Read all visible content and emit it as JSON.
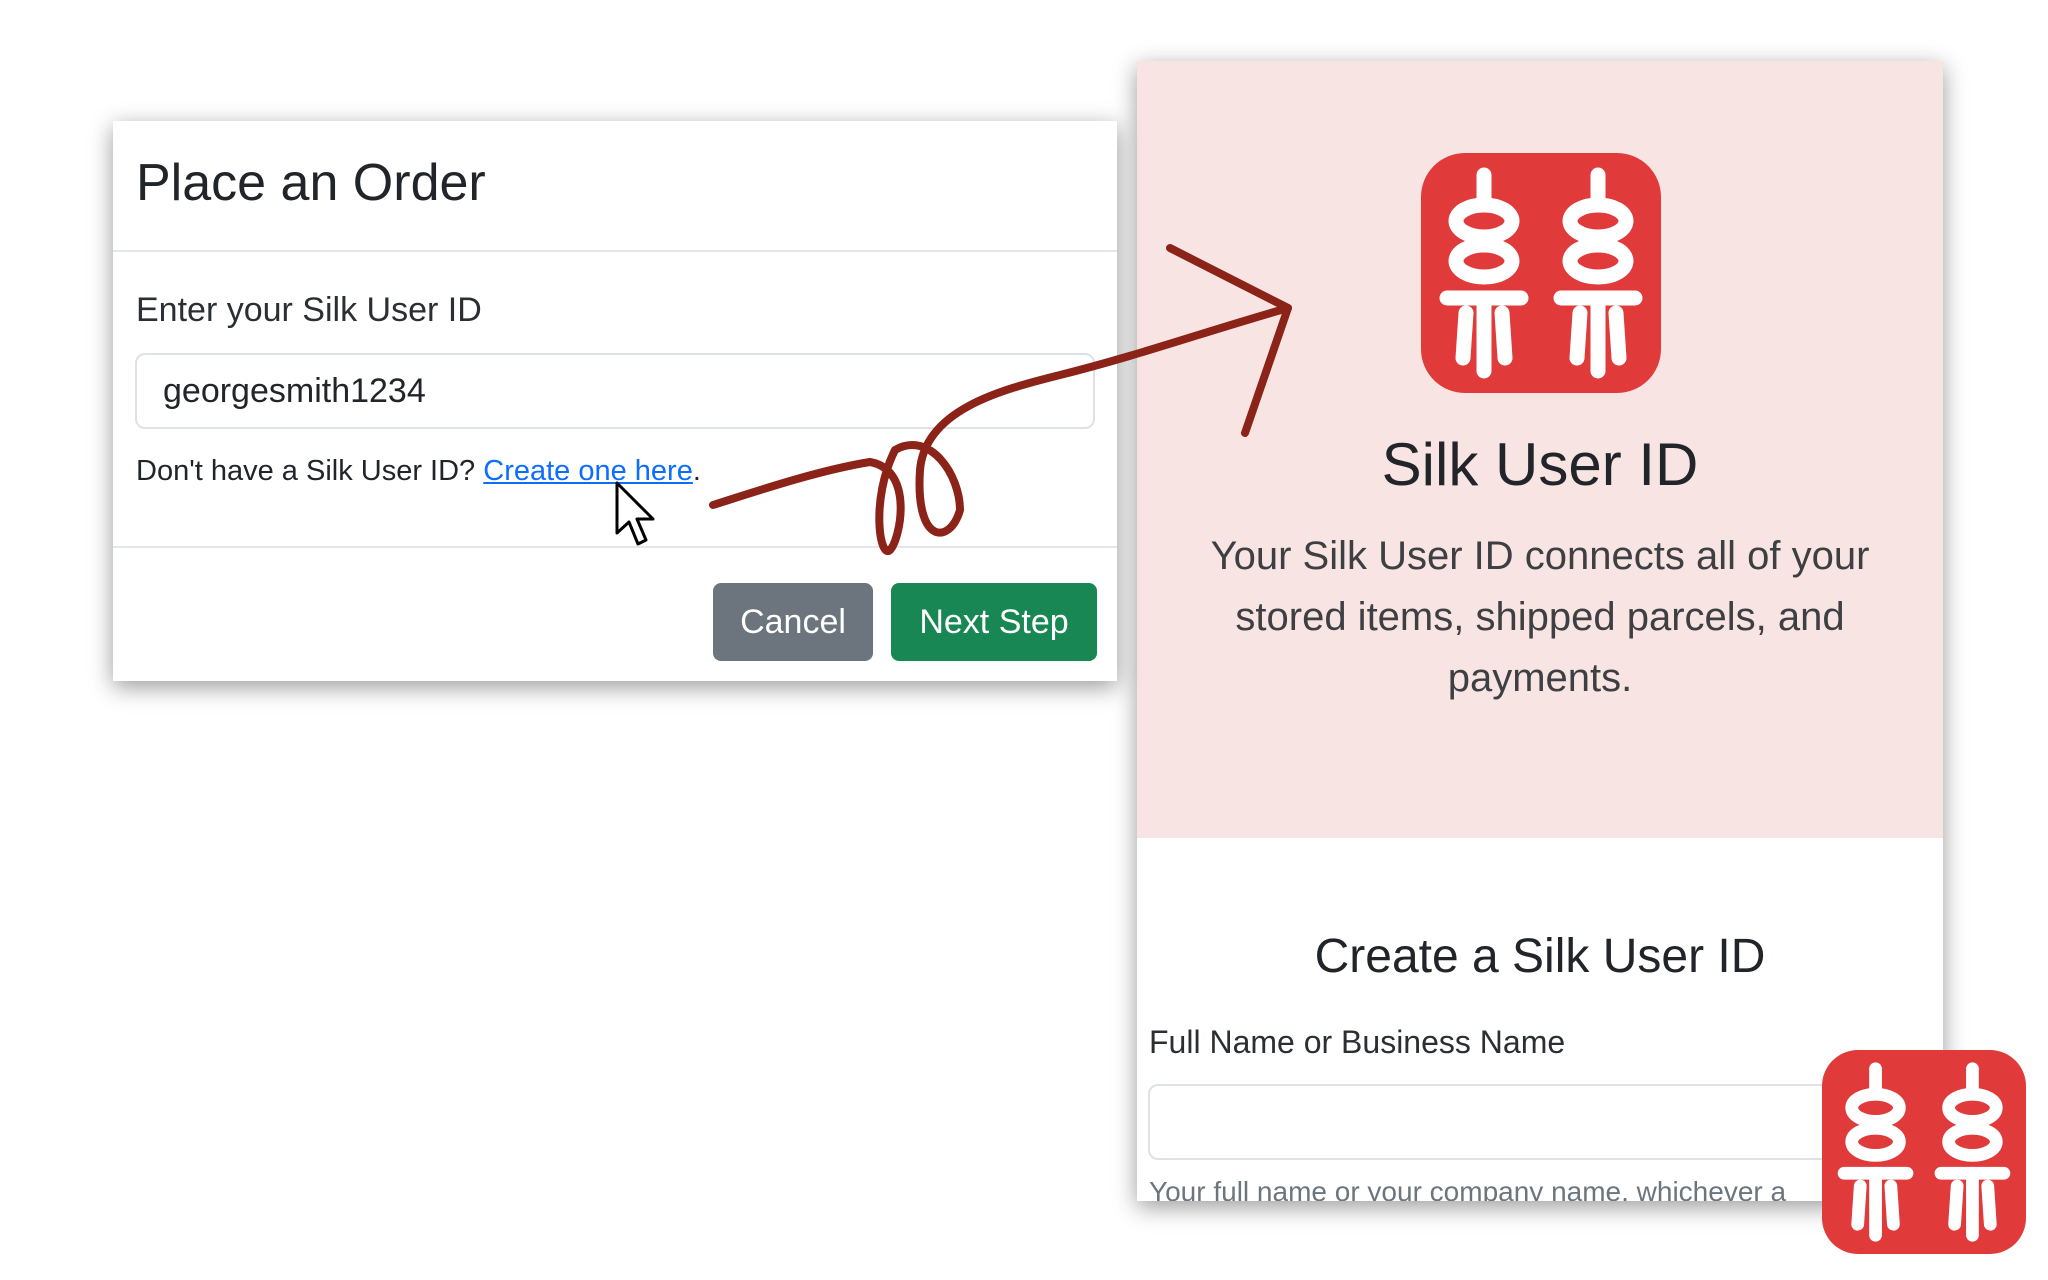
{
  "order_modal": {
    "title": "Place an Order",
    "label": "Enter your Silk User ID",
    "user_id_value": "georgesmith1234",
    "help_prefix": "Don't have a Silk User ID? ",
    "help_link": "Create one here",
    "help_suffix": ".",
    "cancel_label": "Cancel",
    "next_label": "Next Step"
  },
  "silk_panel": {
    "hero_title": "Silk User ID",
    "hero_description": "Your Silk User ID connects all of your stored items, shipped parcels, and payments.",
    "form_title": "Create a Silk User ID",
    "name_label": "Full Name or Business Name",
    "name_value": "",
    "name_help": "Your full name or your company name, whichever a"
  },
  "icons": {
    "logo": "silk-logo-icon",
    "cursor": "mouse-pointer-icon",
    "arrow": "curly-arrow-annotation"
  },
  "colors": {
    "brand_red": "#e03a3a",
    "hero_bg": "#f8e5e3",
    "link_blue": "#0d6efd",
    "cancel_gray": "#6c757d",
    "next_green": "#198754",
    "arrow_color": "#8b2318"
  }
}
